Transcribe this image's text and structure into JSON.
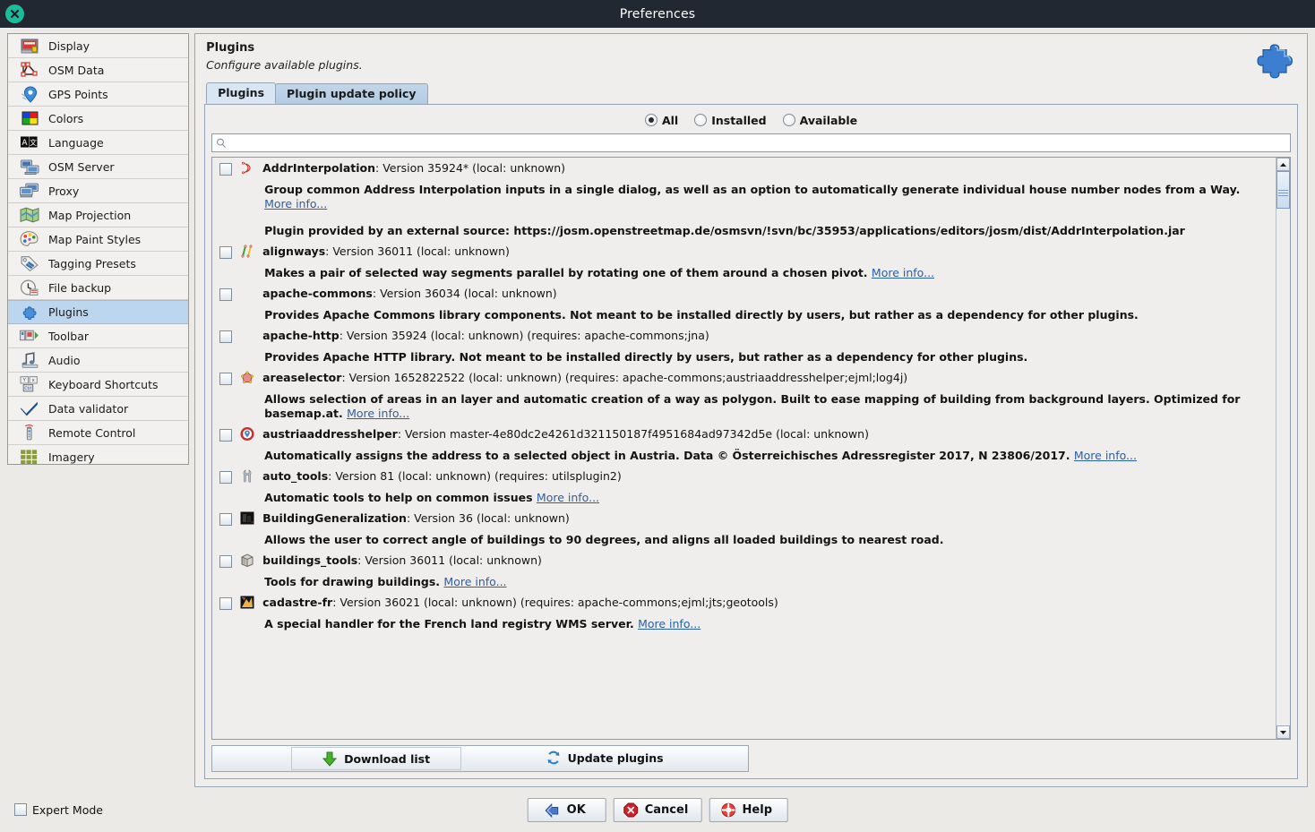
{
  "window": {
    "title": "Preferences",
    "close_icon": "close-icon"
  },
  "sidebar": {
    "items": [
      {
        "label": "Display",
        "icon": "display-icon"
      },
      {
        "label": "OSM Data",
        "icon": "osm-data-icon"
      },
      {
        "label": "GPS Points",
        "icon": "gps-points-icon"
      },
      {
        "label": "Colors",
        "icon": "colors-icon"
      },
      {
        "label": "Language",
        "icon": "language-icon"
      },
      {
        "label": "OSM Server",
        "icon": "osm-server-icon"
      },
      {
        "label": "Proxy",
        "icon": "proxy-icon"
      },
      {
        "label": "Map Projection",
        "icon": "map-projection-icon"
      },
      {
        "label": "Map Paint Styles",
        "icon": "map-paint-styles-icon"
      },
      {
        "label": "Tagging Presets",
        "icon": "tagging-presets-icon"
      },
      {
        "label": "File backup",
        "icon": "file-backup-icon"
      },
      {
        "label": "Plugins",
        "icon": "plugins-icon"
      },
      {
        "label": "Toolbar",
        "icon": "toolbar-icon"
      },
      {
        "label": "Audio",
        "icon": "audio-icon"
      },
      {
        "label": "Keyboard Shortcuts",
        "icon": "keyboard-shortcuts-icon"
      },
      {
        "label": "Data validator",
        "icon": "data-validator-icon"
      },
      {
        "label": "Remote Control",
        "icon": "remote-control-icon"
      },
      {
        "label": "Imagery",
        "icon": "imagery-icon"
      }
    ],
    "selected_index": 11
  },
  "panel": {
    "title": "Plugins",
    "subtitle": "Configure available plugins.",
    "header_icon": "puzzle-piece-icon",
    "tabs": [
      {
        "label": "Plugins",
        "active": true
      },
      {
        "label": "Plugin update policy",
        "active": false
      }
    ],
    "filters": [
      {
        "label": "All",
        "checked": true
      },
      {
        "label": "Installed",
        "checked": false
      },
      {
        "label": "Available",
        "checked": false
      }
    ],
    "search": {
      "value": "",
      "placeholder": "",
      "icon": "search-icon"
    },
    "actions": [
      {
        "label": "Download list",
        "icon": "download-arrow-icon"
      },
      {
        "label": "Update plugins",
        "icon": "refresh-icon"
      }
    ],
    "scrollbar": {
      "up_icon": "scroll-up-icon",
      "down_icon": "scroll-down-icon"
    }
  },
  "plugins": [
    {
      "checked": false,
      "icon": "addrinterpolation-icon",
      "name": "AddrInterpolation",
      "meta": ": Version 35924* (local: unknown)",
      "desc": "Group common Address Interpolation inputs in a single dialog, as well as an option to automatically generate individual house number nodes from a Way.",
      "more_info": "More info...",
      "extra": "Plugin provided by an external source: https://josm.openstreetmap.de/osmsvn/!svn/bc/35953/applications/editors/josm/dist/AddrInterpolation.jar"
    },
    {
      "checked": false,
      "icon": "alignways-icon",
      "name": "alignways",
      "meta": ": Version 36011 (local: unknown)",
      "desc": "Makes a pair of selected way segments parallel by rotating one of them around a chosen pivot.",
      "more_info": "More info...",
      "extra": ""
    },
    {
      "checked": false,
      "icon": "",
      "name": "apache-commons",
      "meta": ": Version 36034 (local: unknown)",
      "desc": "Provides Apache Commons library components. Not meant to be installed directly by users, but rather as a dependency for other plugins.",
      "more_info": "",
      "extra": ""
    },
    {
      "checked": false,
      "icon": "",
      "name": "apache-http",
      "meta": ": Version 35924 (local: unknown) (requires: apache-commons;jna)",
      "desc": "Provides Apache HTTP library. Not meant to be installed directly by users, but rather as a dependency for other plugins.",
      "more_info": "",
      "extra": ""
    },
    {
      "checked": false,
      "icon": "areaselector-icon",
      "name": "areaselector",
      "meta": ": Version 1652822522 (local: unknown) (requires: apache-commons;austriaaddresshelper;ejml;log4j)",
      "desc": "Allows selection of areas in an layer and automatic creation of a way as polygon. Built to ease mapping of building from background layers. Optimized for basemap.at.",
      "more_info": "More info...",
      "extra": ""
    },
    {
      "checked": false,
      "icon": "austriaaddresshelper-icon",
      "name": "austriaaddresshelper",
      "meta": ": Version master-4e80dc2e4261d321150187f4951684ad97342d5e (local: unknown)",
      "desc": "Automatically assigns the address to a selected object in Austria. Data © Österreichisches Adressregister 2017, N 23806/2017.",
      "more_info": "More info...",
      "extra": ""
    },
    {
      "checked": false,
      "icon": "auto-tools-icon",
      "name": "auto_tools",
      "meta": ": Version 81 (local: unknown) (requires: utilsplugin2)",
      "desc": "Automatic tools to help on common issues",
      "more_info": "More info...",
      "extra": ""
    },
    {
      "checked": false,
      "icon": "buildinggeneralization-icon",
      "name": "BuildingGeneralization",
      "meta": ": Version 36 (local: unknown)",
      "desc": "Allows the user to correct angle of buildings to 90 degrees, and aligns all loaded buildings to nearest road.",
      "more_info": "",
      "extra": ""
    },
    {
      "checked": false,
      "icon": "buildings-tools-icon",
      "name": "buildings_tools",
      "meta": ": Version 36011 (local: unknown)",
      "desc": "Tools for drawing buildings.",
      "more_info": "More info...",
      "extra": ""
    },
    {
      "checked": false,
      "icon": "cadastre-fr-icon",
      "name": "cadastre-fr",
      "meta": ": Version 36021 (local: unknown) (requires: apache-commons;ejml;jts;geotools)",
      "desc": "A special handler for the French land registry WMS server.",
      "more_info": "More info...",
      "extra": ""
    }
  ],
  "footer": {
    "expert_mode": {
      "label": "Expert Mode",
      "checked": false
    },
    "buttons": [
      {
        "label": "OK",
        "icon": "ok-arrow-icon"
      },
      {
        "label": "Cancel",
        "icon": "cancel-icon"
      },
      {
        "label": "Help",
        "icon": "help-lifering-icon"
      }
    ]
  },
  "colors": {
    "titlebar_bg": "#222831",
    "close_btn": "#1abc9c",
    "sidebar_selected": "#bcd6ef",
    "link": "#2b5fa8",
    "panel_bg": "#efeeec"
  }
}
